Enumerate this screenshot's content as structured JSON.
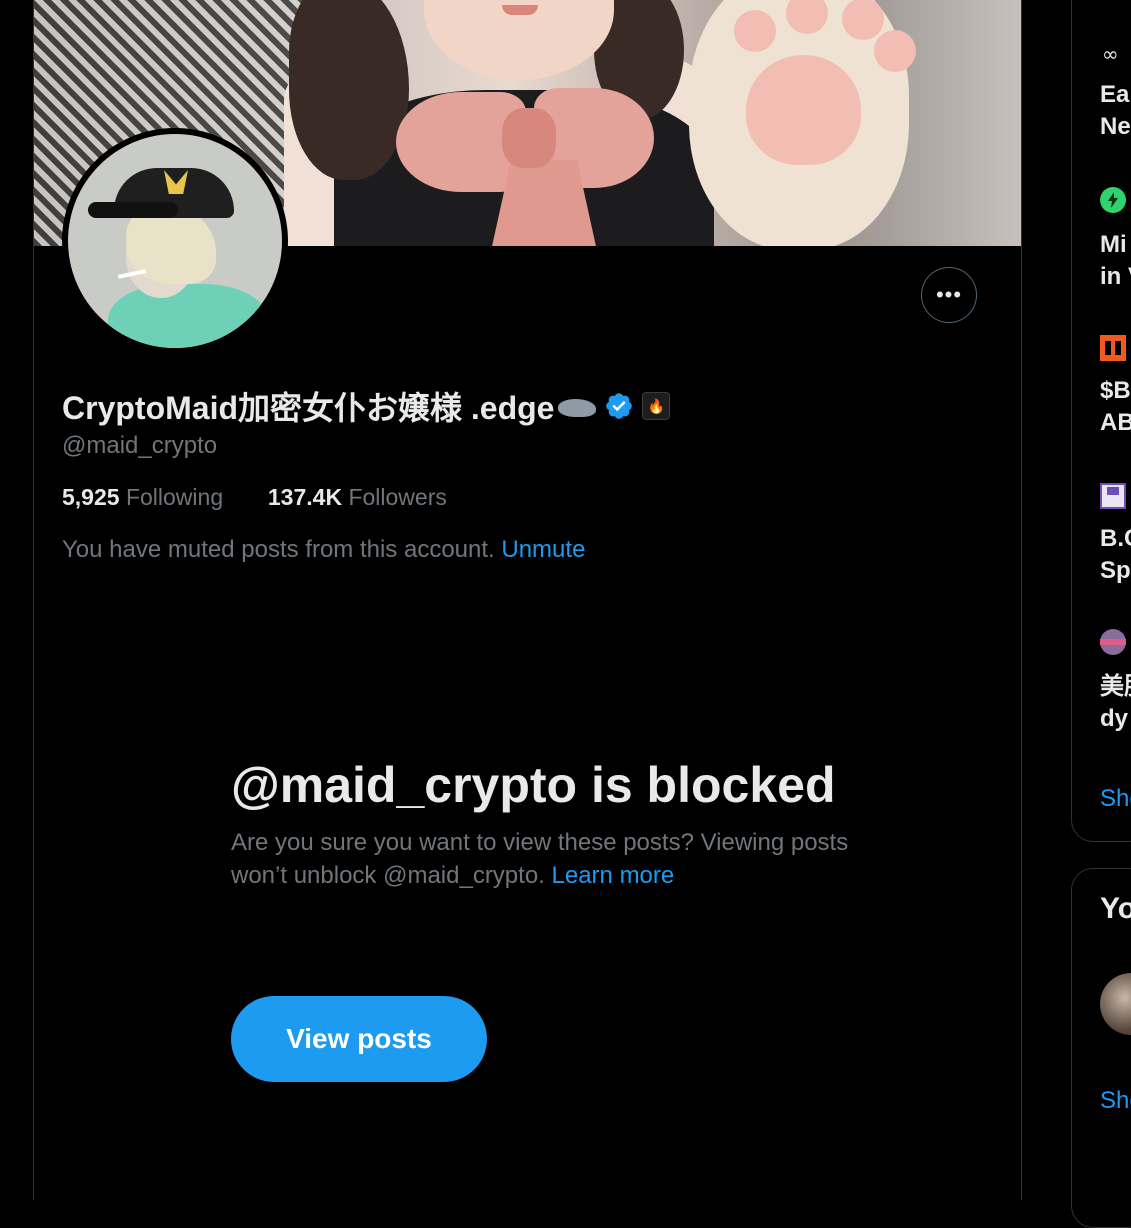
{
  "profile": {
    "display_name": "CryptoMaid加密女仆お嬢様 .edge",
    "handle": "@maid_crypto",
    "following_count": "5,925",
    "following_label": "Following",
    "followers_count": "137.4K",
    "followers_label": "Followers",
    "muted_text": "You have muted posts from this account.",
    "unmute_label": "Unmute",
    "more_label": "•••"
  },
  "blocked_notice": {
    "title": "@maid_crypto is blocked",
    "text": "Are you sure you want to view these posts? Viewing posts won’t unblock @maid_crypto.",
    "learn_more_label": "Learn more",
    "view_posts_label": "View posts"
  },
  "sidebar": {
    "trends": [
      {
        "icon": "infinity-icon",
        "line1": "Ear",
        "line2": "Ne"
      },
      {
        "icon": "lightning-icon",
        "line1": "Mi",
        "line2": "in V"
      },
      {
        "icon": "orange-logo-icon",
        "line1": "$B",
        "line2": "AB"
      },
      {
        "icon": "floppy-icon",
        "line1": "B.C",
        "line2": "Sp"
      },
      {
        "icon": "avatar-icon",
        "line1": "美肌",
        "line2": "dy"
      }
    ],
    "show_more_label": "Sho",
    "who_to_follow_title": "Yo",
    "who_to_follow_show_more": "Sho"
  },
  "colors": {
    "background": "#000000",
    "accent": "#1d9bf0",
    "muted_text": "#71767b",
    "primary_text": "#e7e9ea",
    "border": "#2f3336"
  }
}
